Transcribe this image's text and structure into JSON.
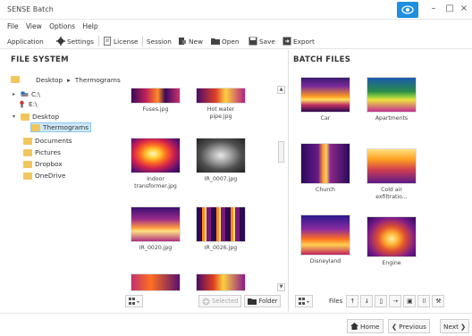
{
  "window": {
    "title": "SENSE Batch"
  },
  "menu": [
    "File",
    "View",
    "Options",
    "Help"
  ],
  "toolbar": {
    "application": "Application",
    "settings": "Settings",
    "license": "License",
    "session": "Session",
    "new": "New",
    "open": "Open",
    "save": "Save",
    "export": "Export"
  },
  "file_system": {
    "title": "FILE SYSTEM",
    "breadcrumb": [
      "Desktop",
      "Thermograms"
    ],
    "tree": [
      {
        "label": "C:\\"
      },
      {
        "label": "E:\\"
      },
      {
        "label": "Desktop"
      },
      {
        "label": "Thermograms",
        "selected": true
      },
      {
        "label": "Documents"
      },
      {
        "label": "Pictures"
      },
      {
        "label": "Dropbox"
      },
      {
        "label": "OneDrive"
      }
    ],
    "thumbnails": [
      {
        "caption": "Fuses.jpg"
      },
      {
        "caption": "Hot water pipe.jpg"
      },
      {
        "caption": "Indoor transformer.jpg"
      },
      {
        "caption": "IR_0007.jpg"
      },
      {
        "caption": "IR_0020.jpg"
      },
      {
        "caption": "IR_0026.jpg"
      }
    ],
    "selected_label": "Selected",
    "folder_label": "Folder"
  },
  "batch_files": {
    "title": "BATCH FILES",
    "thumbnails": [
      {
        "caption": "Car"
      },
      {
        "caption": "Apartments"
      },
      {
        "caption": "Church"
      },
      {
        "caption": "Cold air exfiltratio..."
      },
      {
        "caption": "Disneyland"
      },
      {
        "caption": "Engine"
      }
    ],
    "files_label": "Files"
  },
  "footer": {
    "home": "Home",
    "previous": "Previous",
    "next": "Next"
  },
  "colors": {
    "accent": "#1e8fe1",
    "selection": "#cde8fb",
    "folder": "#f1c75d"
  }
}
